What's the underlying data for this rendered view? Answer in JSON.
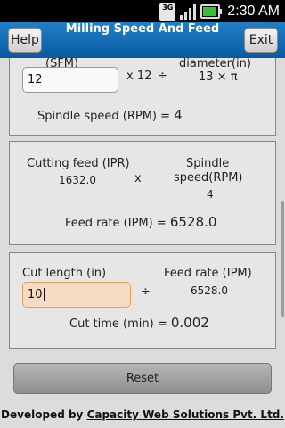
{
  "status_bar": {
    "network_label": "3G",
    "time": "2:30 AM",
    "icons": [
      "network-3g-icon",
      "signal-icon",
      "battery-icon"
    ]
  },
  "title_bar": {
    "help_label": "Help",
    "title": "Milling Speed And Feed",
    "exit_label": "Exit"
  },
  "spindle_section": {
    "sfm_label_partial": "(SFM)",
    "sfm_value": "12",
    "multiply_text": "x 12",
    "divide_symbol": "÷",
    "diameter_label_partial": "diameter(in)",
    "denominator_text": "13 × π",
    "result_label": "Spindle speed (RPM) =",
    "result_value": "4"
  },
  "feed_section": {
    "cutting_feed_label": "Cutting feed (IPR)",
    "cutting_feed_value": "1632.0",
    "multiply_symbol": "x",
    "spindle_speed_label_line1": "Spindle",
    "spindle_speed_label_line2": "speed(RPM)",
    "spindle_speed_value": "4",
    "result_label": "Feed rate (IPM) =",
    "result_value": "6528.0"
  },
  "cut_section": {
    "cut_length_label": "Cut length (in)",
    "cut_length_value": "10",
    "divide_symbol": "÷",
    "feed_rate_label": "Feed rate (IPM)",
    "feed_rate_value": "6528.0",
    "result_label": "Cut time (min) =",
    "result_value": "0.002"
  },
  "reset_label": "Reset",
  "footer": {
    "prefix": "Developed by",
    "company": "Capacity Web Solutions Pvt. Ltd."
  },
  "colors": {
    "title_bar": "#0b5aa0",
    "focused_input": "#f7dcc3",
    "battery": "#38c038"
  }
}
